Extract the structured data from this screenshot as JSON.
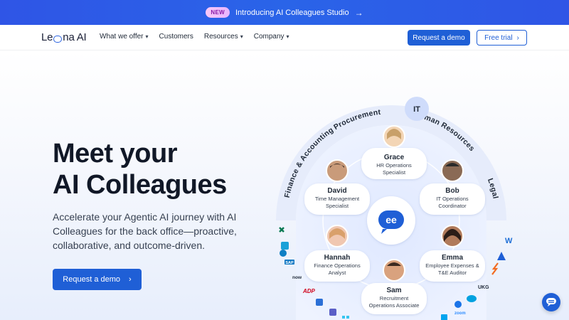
{
  "announcement": {
    "badge": "NEW",
    "text": "Introducing AI Colleagues Studio",
    "arrow": "→"
  },
  "nav": {
    "logo_pre": "Le",
    "logo_post": "na AI",
    "links": [
      {
        "label": "What we offer",
        "chevron": "⌄"
      },
      {
        "label": "Customers",
        "chevron": ""
      },
      {
        "label": "Resources",
        "chevron": "⌄"
      },
      {
        "label": "Company",
        "chevron": "⌄"
      }
    ],
    "request_demo": "Request a demo",
    "free_trial": "Free trial",
    "trial_arrow": "›"
  },
  "hero": {
    "headline_1": "Meet your",
    "headline_2": "AI Colleagues",
    "subtext": "Accelerate your Agentic AI journey with AI Colleagues for the back office—proactive, collaborative, and outcome-driven.",
    "cta": "Request a demo",
    "cta_arrow": "›"
  },
  "diagram": {
    "departments": [
      "Finance & Accounting",
      "Procurement",
      "IT",
      "Human Resources",
      "Legal"
    ],
    "colleagues": [
      {
        "name": "Grace",
        "role_1": "HR Operations",
        "role_2": "Specialist"
      },
      {
        "name": "David",
        "role_1": "Time Management",
        "role_2": "Specialist"
      },
      {
        "name": "Bob",
        "role_1": "IT Operations",
        "role_2": "Coordinator"
      },
      {
        "name": "Hannah",
        "role_1": "Finance Operations",
        "role_2": "Analyst"
      },
      {
        "name": "Emma",
        "role_1": "Employee Expenses &",
        "role_2": "T&E Auditor"
      },
      {
        "name": "Sam",
        "role_1": "Recruitment",
        "role_2": "Operations Associate"
      }
    ],
    "integrations": [
      "now",
      "SAP",
      "UKG",
      "ADP",
      "zoom"
    ]
  },
  "colors": {
    "accent": "#1f5fd6",
    "banner": "#2f55e6",
    "badge_text": "#8a1aa8"
  }
}
